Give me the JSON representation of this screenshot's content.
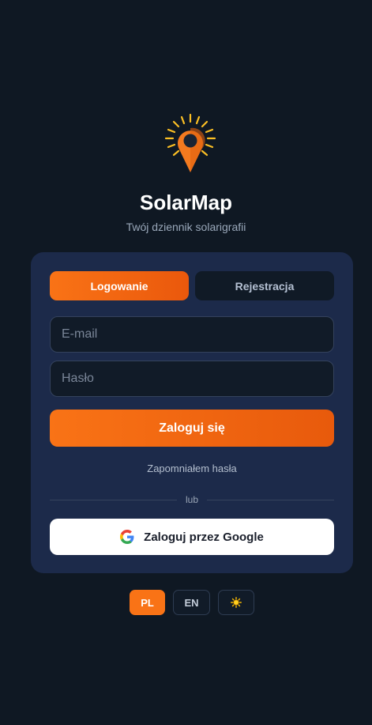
{
  "app": {
    "title": "SolarMap",
    "subtitle": "Twój dziennik solarigrafii"
  },
  "logo": {
    "icon": "sun-map-pin-icon"
  },
  "tabs": [
    {
      "label": "Logowanie",
      "active": true
    },
    {
      "label": "Rejestracja",
      "active": false
    }
  ],
  "form": {
    "email_placeholder": "E-mail",
    "email_value": "",
    "password_placeholder": "Hasło",
    "password_value": "",
    "submit_label": "Zaloguj się",
    "forgot_label": "Zapomniałem hasła",
    "divider_label": "lub",
    "google_label": "Zaloguj przez Google",
    "google_icon": "google-icon"
  },
  "footer": {
    "languages": [
      {
        "code": "PL",
        "active": true
      },
      {
        "code": "EN",
        "active": false
      }
    ],
    "theme_icon": "sun-icon"
  },
  "colors": {
    "background": "#0f1823",
    "card": "#1c2a4a",
    "accent": "#f97316",
    "accent_dark": "#ea580c",
    "sun_yellow": "#fbbf24"
  }
}
